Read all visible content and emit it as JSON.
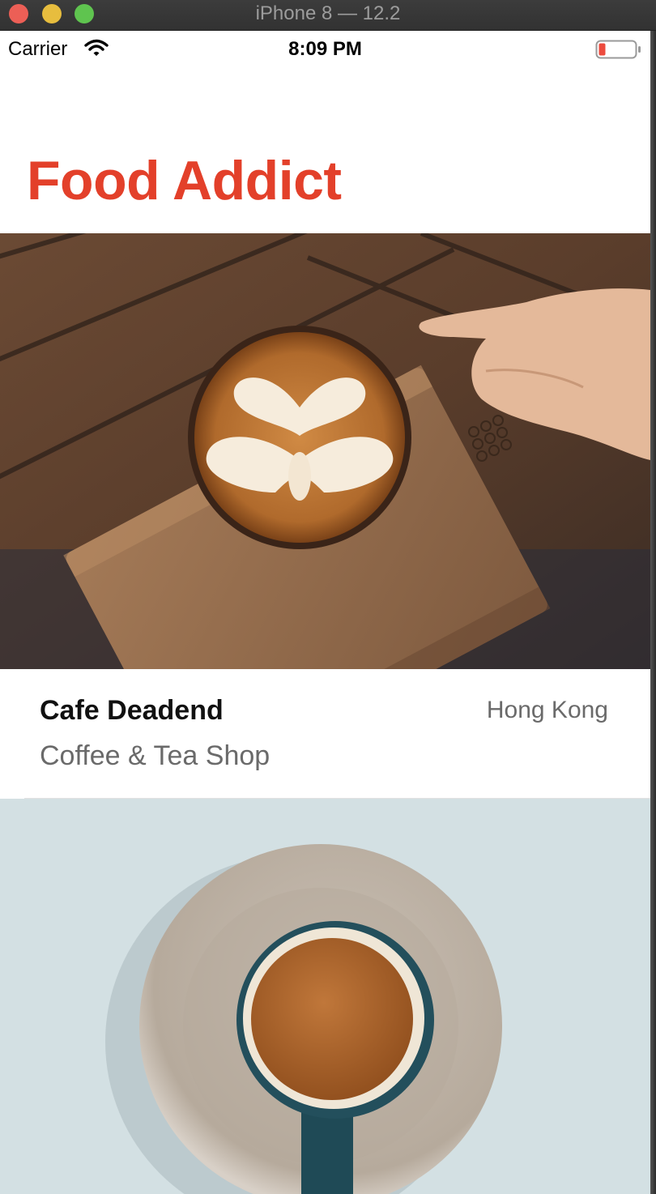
{
  "window": {
    "title": "iPhone 8 — 12.2"
  },
  "status_bar": {
    "carrier": "Carrier",
    "time": "8:09 PM",
    "battery_color": "#ec4b3e"
  },
  "app": {
    "title": "Food Addict",
    "accent": "#e3402a"
  },
  "restaurants": [
    {
      "name": "Cafe Deadend",
      "type": "Coffee & Tea Shop",
      "location": "Hong Kong",
      "photo": "latte-art-on-wooden-tray"
    },
    {
      "photo": "coffee-cup-on-saucer"
    }
  ]
}
